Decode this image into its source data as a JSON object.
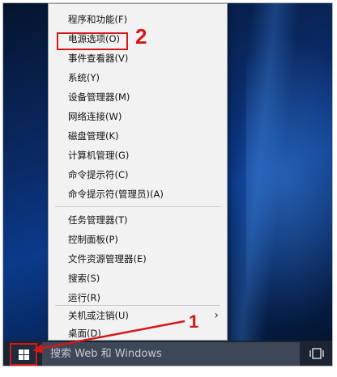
{
  "menu": {
    "items": [
      {
        "label": "程序和功能(F)"
      },
      {
        "label": "电源选项(O)"
      },
      {
        "label": "事件查看器(V)"
      },
      {
        "label": "系统(Y)"
      },
      {
        "label": "设备管理器(M)"
      },
      {
        "label": "网络连接(W)"
      },
      {
        "label": "磁盘管理(K)"
      },
      {
        "label": "计算机管理(G)"
      },
      {
        "label": "命令提示符(C)"
      },
      {
        "label": "命令提示符(管理员)(A)"
      },
      {
        "label": "任务管理器(T)"
      },
      {
        "label": "控制面板(P)"
      },
      {
        "label": "文件资源管理器(E)"
      },
      {
        "label": "搜索(S)"
      },
      {
        "label": "运行(R)"
      },
      {
        "label": "关机或注销(U)"
      },
      {
        "label": "桌面(D)"
      }
    ],
    "submenu_arrow": "›"
  },
  "annotations": {
    "step1": "1",
    "step2": "2",
    "accent_color": "#d1191b"
  },
  "taskbar": {
    "search_text": "搜索 Web 和 Windows",
    "start_icon": "windows-logo-icon",
    "task_view_icon": "task-view-icon"
  }
}
